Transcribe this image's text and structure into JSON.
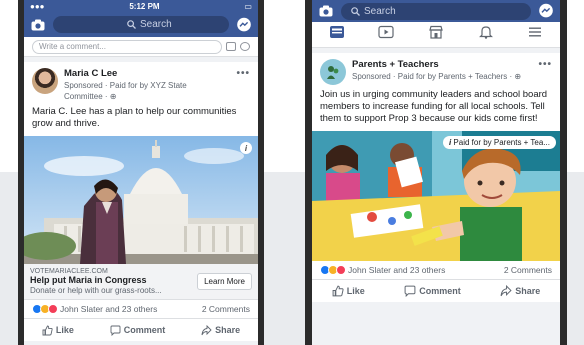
{
  "left_phone": {
    "status": {
      "center": "5:12 PM"
    },
    "search_placeholder": "Search",
    "comment_placeholder": "Write a comment...",
    "post": {
      "author": "Maria C Lee",
      "meta_line1": "Sponsored · Paid for by XYZ State",
      "meta_line2": "Committee · ⊕",
      "text": "Maria C. Lee has a plan to help our communities grow and thrive.",
      "link_url": "VOTEMARIACLEE.COM",
      "link_title": "Help put Maria in Congress",
      "link_desc": "Donate or help with our grass-roots...",
      "cta": "Learn More",
      "reactions_text": "John Slater and 23 others",
      "comments": "2 Comments",
      "like": "Like",
      "comment": "Comment",
      "share": "Share"
    }
  },
  "right_phone": {
    "search_placeholder": "Search",
    "post": {
      "author": "Parents + Teachers",
      "meta": "Sponsored · Paid for by Parents + Teachers · ⊕",
      "text": "Join us in urging community leaders and school board members to increase funding for all local schools. Tell them to support Prop 3 because our kids come first!",
      "paid_badge": "Paid for by Parents + Tea...",
      "reactions_text": "John Slater and 23 others",
      "comments": "2 Comments",
      "like": "Like",
      "comment": "Comment",
      "share": "Share"
    }
  },
  "colors": {
    "facebook_blue": "#3b5998",
    "search_field": "#2d4373",
    "like_reaction": "#1877f2",
    "love_reaction": "#f33e58",
    "haha_reaction": "#f7b125"
  },
  "icons": [
    "camera-icon",
    "search-icon",
    "messenger-icon",
    "news-feed-icon",
    "watch-icon",
    "marketplace-icon",
    "bell-icon",
    "menu-icon",
    "globe-icon",
    "info-icon",
    "like-icon",
    "comment-icon",
    "share-icon"
  ]
}
